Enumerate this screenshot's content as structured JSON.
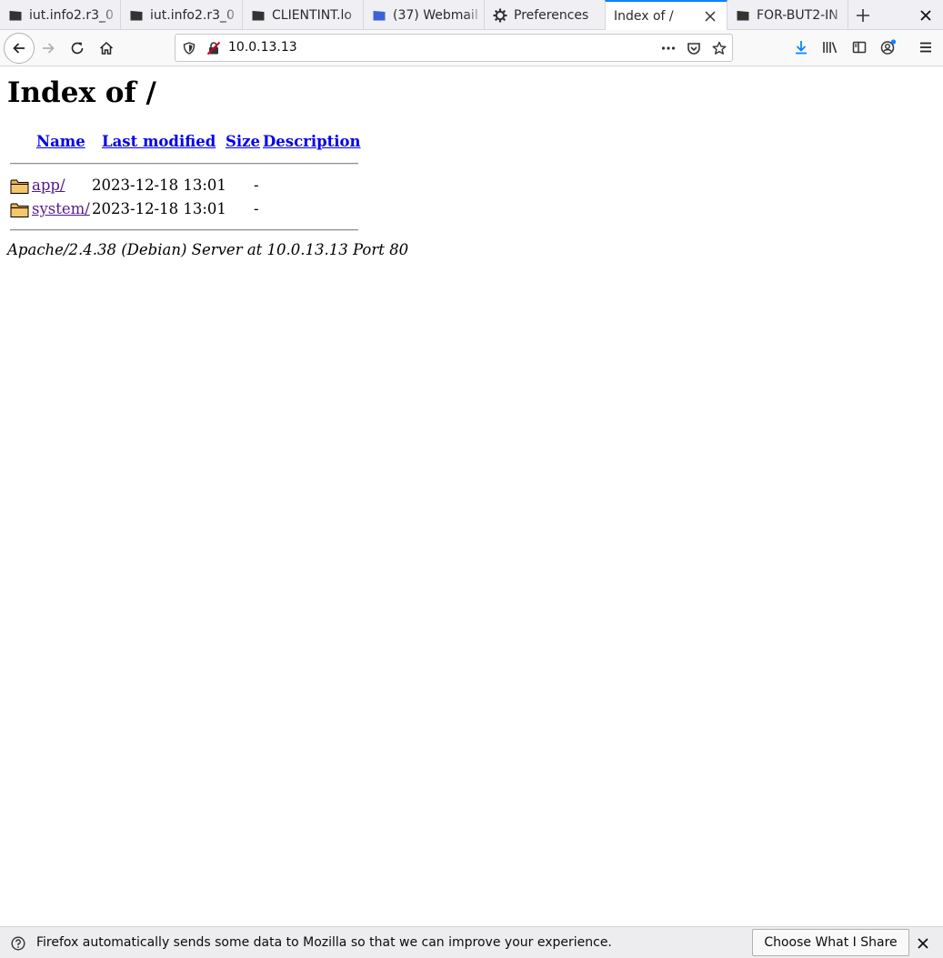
{
  "browser": {
    "tabs": [
      {
        "title": "iut.info2.r3_0",
        "favicon": "moodle-icon"
      },
      {
        "title": "iut.info2.r3_0",
        "favicon": "moodle-icon"
      },
      {
        "title": "CLIENTINT.lo",
        "favicon": "moodle-icon"
      },
      {
        "title": "(37) Webmail",
        "favicon": "webmail-icon"
      },
      {
        "title": "Preferences",
        "favicon": "gear-icon"
      },
      {
        "title": "Index of /",
        "favicon": "none",
        "active": true
      },
      {
        "title": "FOR-BUT2-IN",
        "favicon": "moodle-icon"
      }
    ],
    "url": "10.0.13.13",
    "colors": {
      "accent": "#0a84ff",
      "download": "#0a84ff",
      "link": "#0000ee",
      "visited": "#551a8b"
    }
  },
  "page": {
    "heading": "Index of /",
    "columns": {
      "name": "Name",
      "last_modified": "Last modified",
      "size": "Size",
      "description": "Description"
    },
    "rows": [
      {
        "name": "app/",
        "last_modified": "2023-12-18 13:01",
        "size": "-",
        "description": ""
      },
      {
        "name": "system/",
        "last_modified": "2023-12-18 13:01",
        "size": "-",
        "description": ""
      }
    ],
    "address": "Apache/2.4.38 (Debian) Server at 10.0.13.13 Port 80"
  },
  "notification": {
    "message": "Firefox automatically sends some data to Mozilla so that we can improve your experience.",
    "button": "Choose What I Share"
  }
}
